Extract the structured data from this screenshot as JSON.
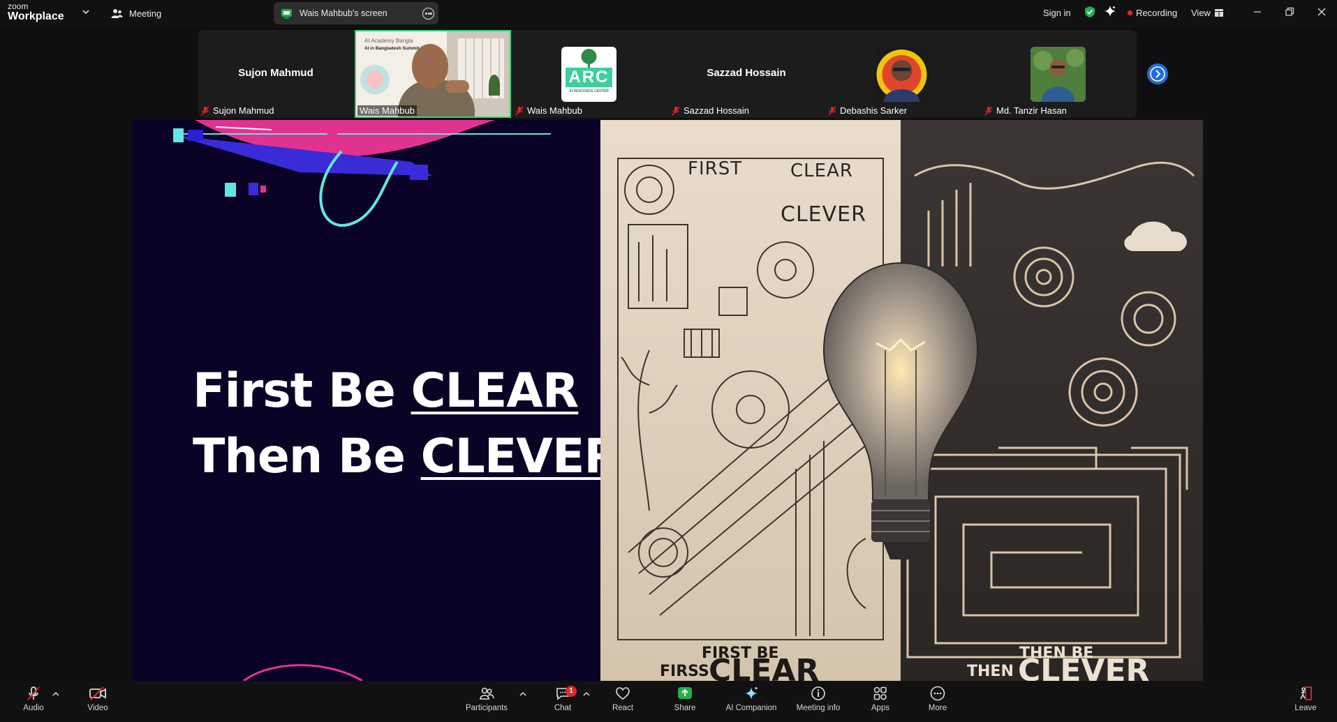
{
  "app": {
    "brand_line1": "zoom",
    "brand_line2": "Workplace",
    "meeting_label": "Meeting",
    "share_pill_label": "Wais Mahbub's screen",
    "sign_in": "Sign in",
    "recording": "Recording",
    "view": "View"
  },
  "participants": [
    {
      "name": "Sujon Mahmud",
      "label": "Sujon Mahmud",
      "muted": true,
      "display": "name"
    },
    {
      "name": "Wais Mahbub",
      "label": "Wais Mahbub",
      "muted": false,
      "display": "video",
      "active_speaker": true
    },
    {
      "name": "Wais Mahbub",
      "label": "Wais Mahbub",
      "muted": true,
      "display": "avatar-logo"
    },
    {
      "name": "Sazzad Hossain",
      "label": "Sazzad Hossain",
      "muted": true,
      "display": "name"
    },
    {
      "name": "Debashis Sarker",
      "label": "Debashis Sarker",
      "muted": true,
      "display": "avatar-photo"
    },
    {
      "name": "Md. Tanzir Hasan",
      "label": "Md. Tanzir Hasan",
      "muted": true,
      "display": "avatar-photo"
    }
  ],
  "logo_tile": {
    "big": "ARC",
    "small": "AI RESOURCE CENTER"
  },
  "video_overlay": {
    "line1": "AI Academy Bangla",
    "line2": "AI in Bangladesh Summit"
  },
  "slide": {
    "line1_prefix": "First Be ",
    "line1_emph": "CLEAR",
    "line2_prefix": "Then Be ",
    "line2_emph": "CLEVER",
    "art_first": "FIRST",
    "art_clear": "CLEAR",
    "art_clever": "CLEVER",
    "art_first_be": "FIRST BE",
    "art_firss": "FIRSS",
    "art_clear_big": "CLEAR",
    "art_then_be": "THEN BE",
    "art_then": "THEN",
    "art_clever_big": "CLEVER"
  },
  "toolbar": {
    "audio": "Audio",
    "video": "Video",
    "participants": "Participants",
    "chat": "Chat",
    "chat_badge": "1",
    "react": "React",
    "share": "Share",
    "ai_companion": "AI Companion",
    "meeting_info": "Meeting info",
    "apps": "Apps",
    "more": "More",
    "leave": "Leave"
  },
  "colors": {
    "accent_blue": "#1f6dda",
    "share_green": "#22b04b",
    "mute_red": "#e02828",
    "speaker_green": "#2fd67b",
    "slide_bg": "#0b0326"
  }
}
